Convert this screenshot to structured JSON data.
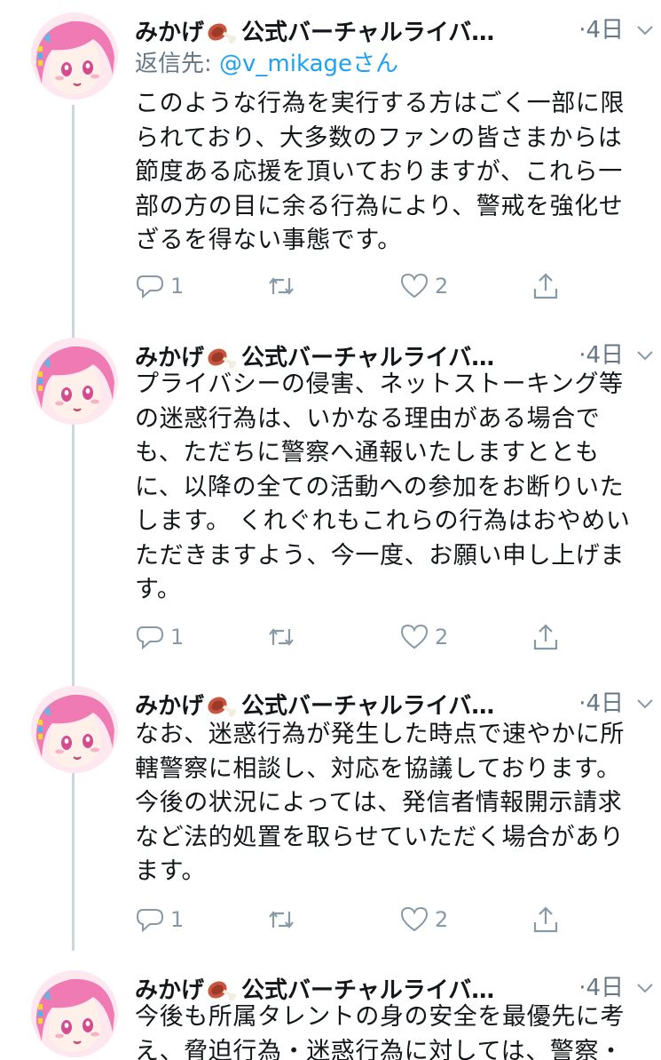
{
  "tweets": [
    {
      "author": "みかげ",
      "author_suffix": "公式バーチャルライバ…",
      "time": "4日",
      "reply_label": "返信先: ",
      "reply_handle": "@v_mikageさん",
      "text": "このような行為を実行する方はごく一部に限られており、大多数のファンの皆さまからは節度ある応援を頂いておりますが、これら一部の方の目に余る行為により、警戒を強化せざるを得ない事態です。",
      "replies": "1",
      "likes": "2"
    },
    {
      "author": "みかげ",
      "author_suffix": "公式バーチャルライバ…",
      "time": "4日",
      "text": "プライバシーの侵害、ネットストーキング等の迷惑行為は、いかなる理由がある場合でも、ただちに警察へ通報いたしますとともに、以降の全ての活動への参加をお断りいたします。 くれぐれもこれらの行為はおやめいただきますよう、今一度、お願い申し上げます。",
      "replies": "1",
      "likes": "2"
    },
    {
      "author": "みかげ",
      "author_suffix": "公式バーチャルライバ…",
      "time": "4日",
      "text": "なお、迷惑行為が発生した時点で速やかに所轄警察に相談し、対応を協議しております。今後の状況によっては、発信者情報開示請求など法的処置を取らせていただく場合があります。",
      "replies": "1",
      "likes": "2"
    },
    {
      "author": "みかげ",
      "author_suffix": "公式バーチャルライバ…",
      "time": "4日",
      "text": "今後も所属タレントの身の安全を最優先に考え、脅迫行為・迷惑行為に対しては、警察・"
    }
  ],
  "icons": {
    "avatar": "anime-avatar-icon",
    "meat": "meat-on-bone-icon",
    "reply": "reply-bubble-icon",
    "retweet": "retweet-icon",
    "like": "heart-icon",
    "share": "share-icon",
    "more": "chevron-down-icon"
  },
  "colors": {
    "text": "#14171a",
    "secondary": "#657786",
    "link": "#1da1f2",
    "action": "#8899a6",
    "thread_line": "#ccd6dd"
  }
}
